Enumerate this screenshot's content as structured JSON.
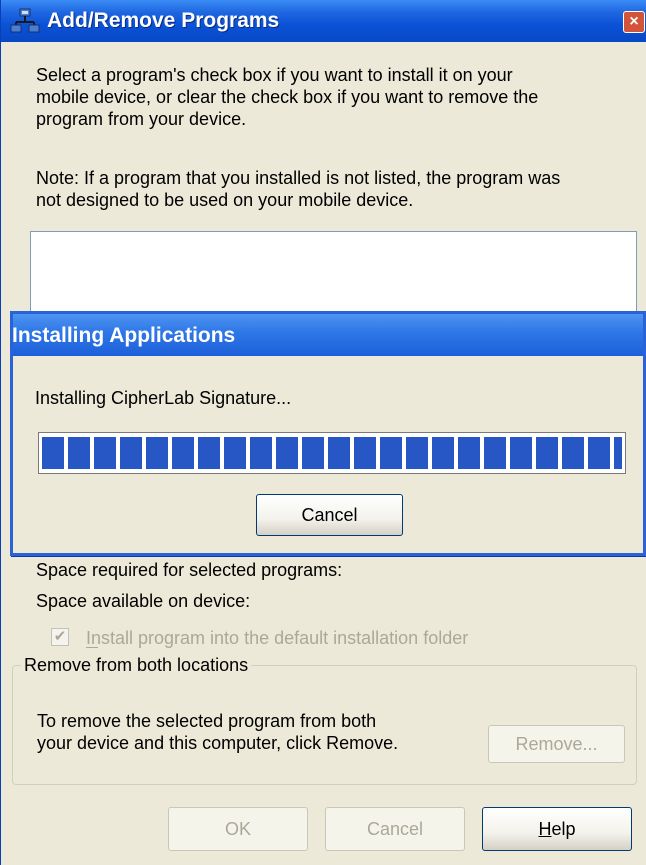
{
  "window": {
    "title": "Add/Remove Programs",
    "icon": "network-computers-icon",
    "close_label": "×"
  },
  "instructions": {
    "line1": "Select a program's check box if you want to install it on your",
    "line2": "mobile device, or clear the check box if you want to remove the",
    "line3": "program from your device.",
    "note_line1": "Note:  If a program that you installed is not listed, the program was",
    "note_line2": "not designed to be used on your mobile device."
  },
  "space": {
    "required_label": "Space required for selected programs:",
    "available_label": "Space available on device:"
  },
  "install_default": {
    "label": "Install program into the default installation folder",
    "checked": true,
    "enabled": false
  },
  "remove_group": {
    "legend": "Remove from both locations",
    "line1": "To remove the selected program from both",
    "line2": "your device and this computer, click Remove.",
    "button_label": "Remove..."
  },
  "buttons": {
    "ok": "OK",
    "cancel": "Cancel",
    "help": "Help"
  },
  "progress_dialog": {
    "title": "Installing Applications",
    "status": "Installing CipherLab Signature...",
    "progress": 1.0,
    "cancel_label": "Cancel"
  },
  "colors": {
    "titlebar_blue": "#0a52d6",
    "progress_blue": "#2757c5",
    "dialog_face": "#ece9d8",
    "close_red": "#d2553b"
  }
}
